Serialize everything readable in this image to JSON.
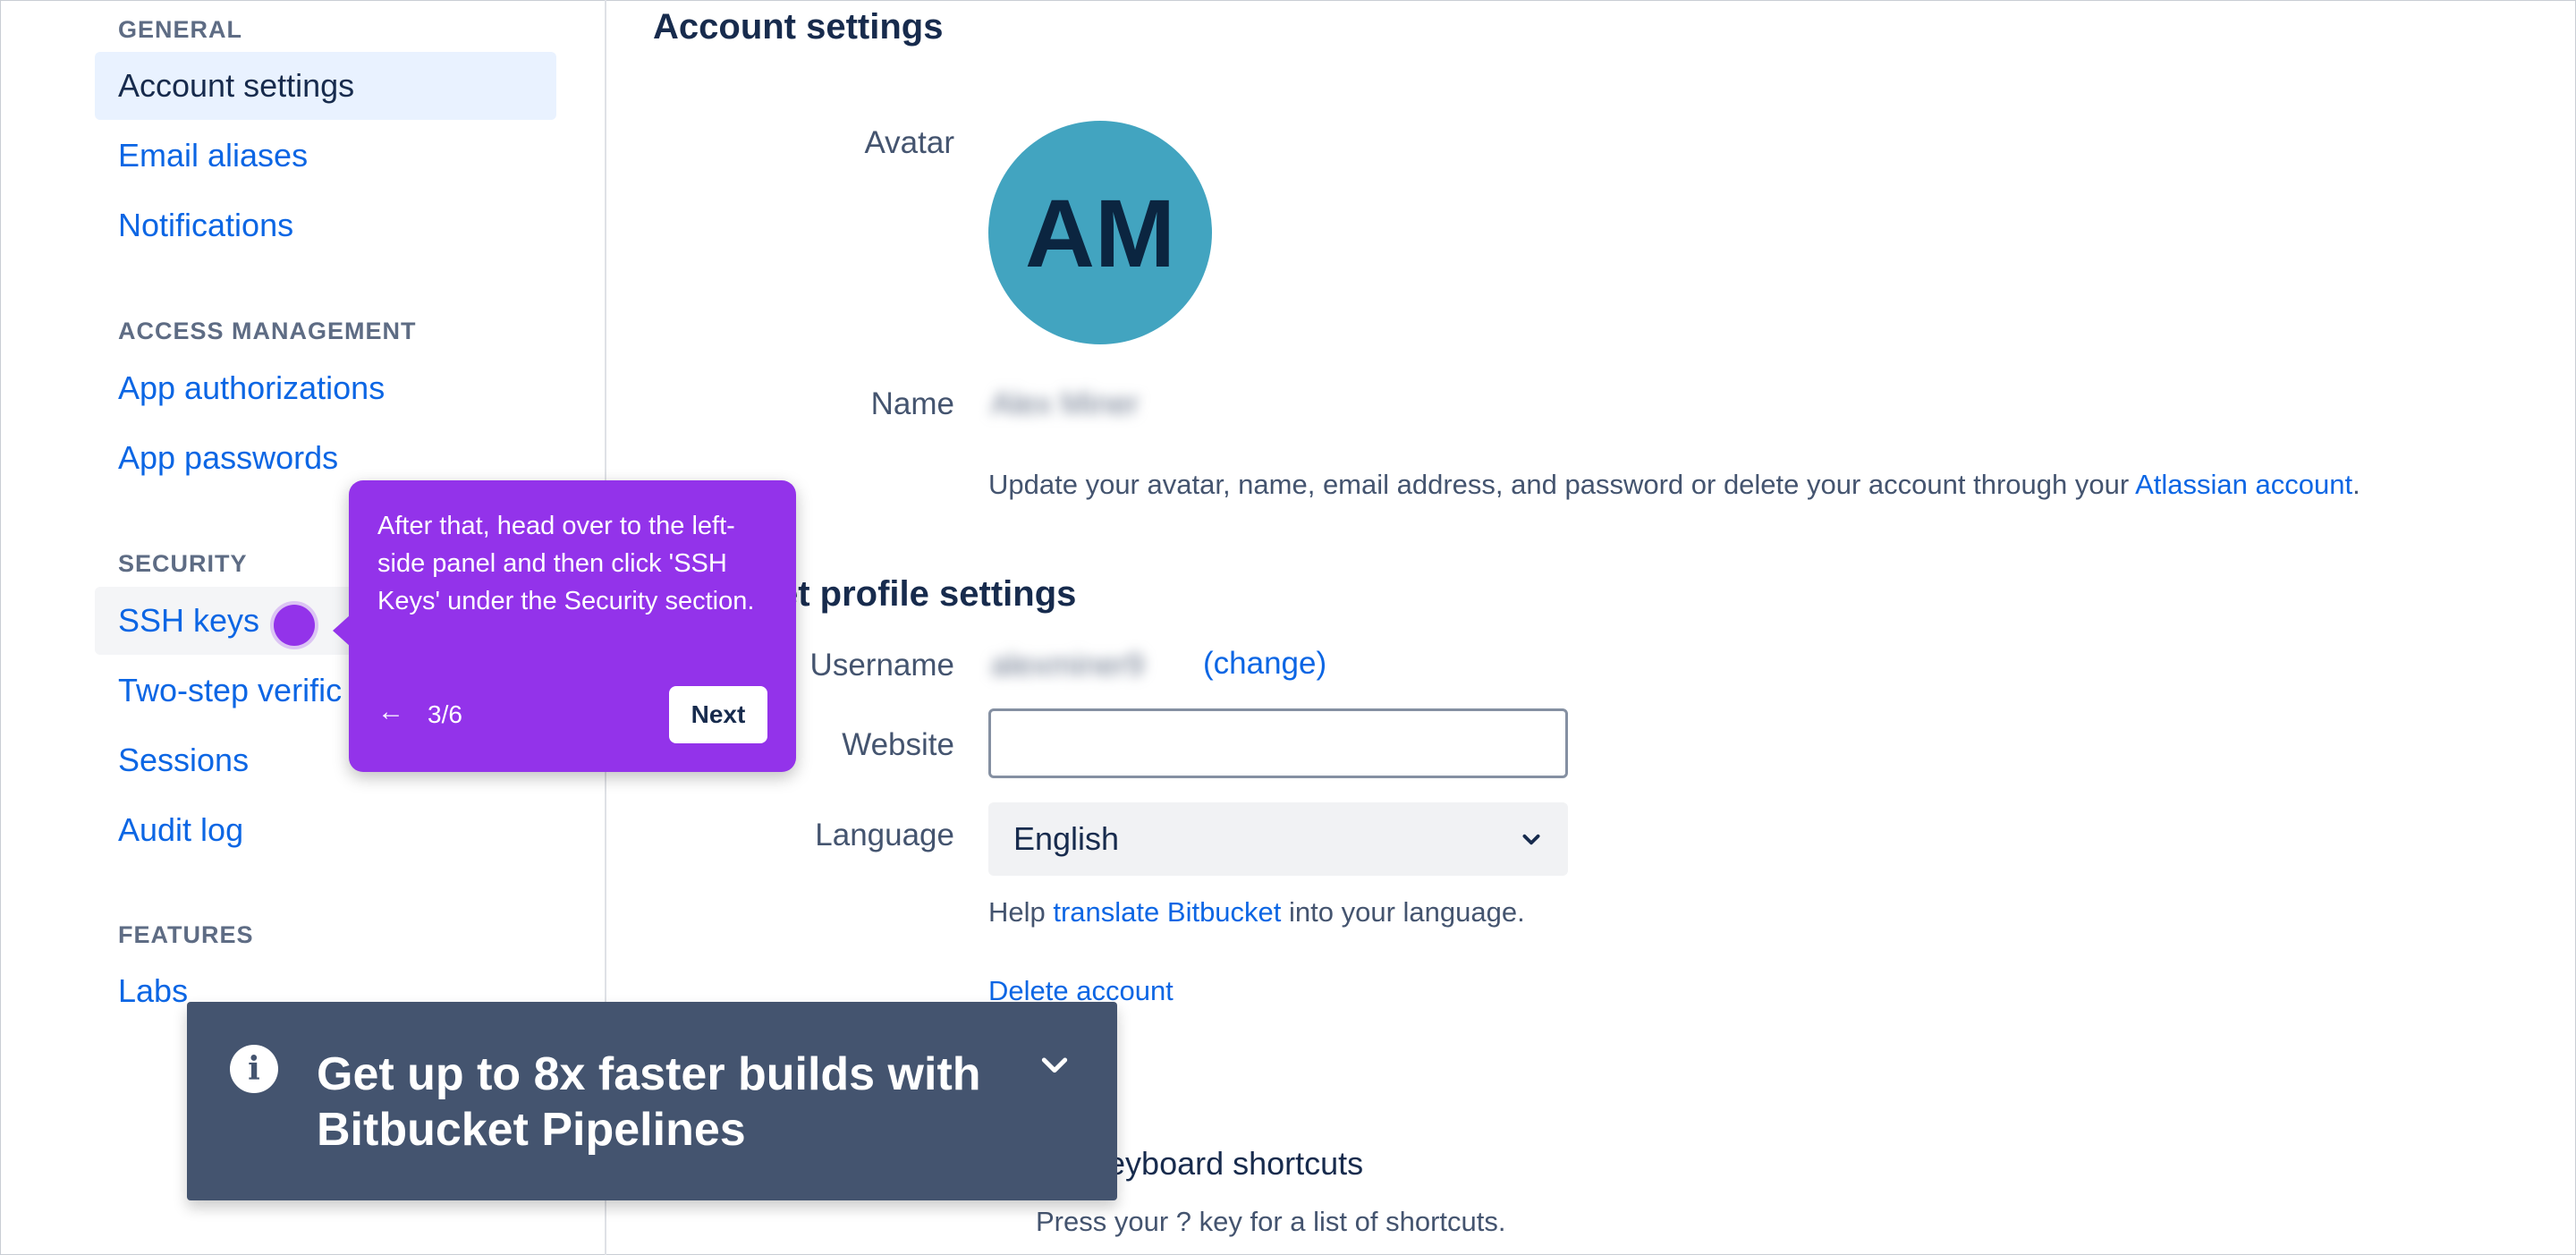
{
  "sidebar": {
    "sections": [
      {
        "title": "GENERAL",
        "items": [
          "Account settings",
          "Email aliases",
          "Notifications"
        ]
      },
      {
        "title": "ACCESS MANAGEMENT",
        "items": [
          "App authorizations",
          "App passwords"
        ]
      },
      {
        "title": "SECURITY",
        "items": [
          "SSH keys",
          "Two-step verific",
          "Sessions",
          "Audit log"
        ]
      },
      {
        "title": "FEATURES",
        "items": [
          "Labs"
        ]
      }
    ]
  },
  "main": {
    "title": "Account settings",
    "avatar_label": "Avatar",
    "avatar_initials": "AM",
    "name_label": "Name",
    "name_value_blurred": "Alex Miner",
    "atlassian_help_prefix": "Update your avatar, name, email address, and password or delete your account through your ",
    "atlassian_link": "Atlassian account",
    "atlassian_help_suffix": ".",
    "profile_heading": "et profile settings",
    "username_label": "Username",
    "username_value_blurred": "alexminer9",
    "username_change": "(change)",
    "website_label": "Website",
    "website_value": "",
    "language_label": "Language",
    "language_value": "English",
    "translate_prefix": "Help ",
    "translate_link": "translate Bitbucket",
    "translate_suffix": " into your language.",
    "delete_account": "Delete account",
    "shortcuts_label": "e keyboard shortcuts",
    "shortcuts_help": "Press your ? key for a list of shortcuts."
  },
  "tooltip": {
    "text": "After that, head over to the left-side panel and then click 'SSH Keys' under the Security section.",
    "step": "3/6",
    "back_icon": "←",
    "next_label": "Next"
  },
  "banner": {
    "info_icon": "i",
    "text": "Get up to 8x faster builds with Bitbucket Pipelines"
  },
  "colors": {
    "accent": "#9333ea",
    "link": "#0c66e4",
    "banner": "#44546f",
    "avatar": "#42a4c0"
  }
}
